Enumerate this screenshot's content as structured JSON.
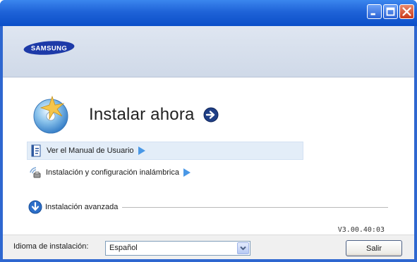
{
  "window": {
    "controls": {
      "minimize_icon": "minimize-icon",
      "maximize_icon": "maximize-icon",
      "close_icon": "close-icon"
    }
  },
  "header": {
    "logo_text": "SAMSUNG",
    "logo_color": "#1d3aa8"
  },
  "install_now": {
    "label": "Instalar ahora",
    "icon": "install-disc-icon",
    "arrow_icon": "arrow-right-circle-icon"
  },
  "links": [
    {
      "label": "Ver el Manual de Usuario",
      "icon": "manual-book-icon",
      "highlighted": true
    },
    {
      "label": "Instalación y configuración inalámbrica",
      "icon": "wireless-icon",
      "highlighted": false
    }
  ],
  "advanced": {
    "label": "Instalación avanzada",
    "icon": "download-arrow-icon"
  },
  "version": "V3.00.40:03",
  "footer": {
    "language_label": "Idioma de instalación:",
    "language_value": "Español",
    "exit_label": "Salir"
  },
  "colors": {
    "accent": "#4a98e6",
    "titlebar": "#1f63d8",
    "highlight": "#e3edf8"
  }
}
